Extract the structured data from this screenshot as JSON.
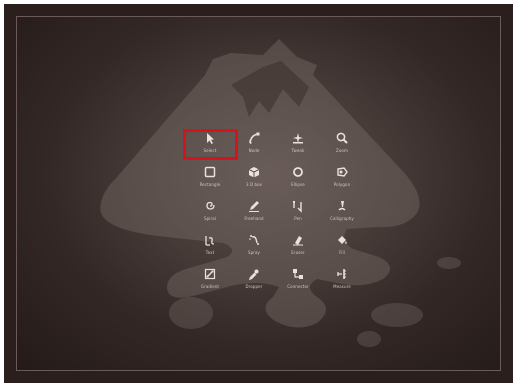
{
  "tools": [
    {
      "label": "Select",
      "icon": "select-arrow-icon"
    },
    {
      "label": "Node",
      "icon": "node-tool-icon"
    },
    {
      "label": "Tweak",
      "icon": "tweak-tool-icon"
    },
    {
      "label": "Zoom",
      "icon": "zoom-icon"
    },
    {
      "label": "Rectangle",
      "icon": "rectangle-icon"
    },
    {
      "label": "3 D box",
      "icon": "3d-box-icon"
    },
    {
      "label": "Ellipse",
      "icon": "ellipse-icon"
    },
    {
      "label": "Polygon",
      "icon": "polygon-star-icon"
    },
    {
      "label": "Spiral",
      "icon": "spiral-icon"
    },
    {
      "label": "Freehand",
      "icon": "pencil-icon"
    },
    {
      "label": "Pen",
      "icon": "pen-icon"
    },
    {
      "label": "Calligraphy",
      "icon": "calligraphy-icon"
    },
    {
      "label": "Text",
      "icon": "text-icon"
    },
    {
      "label": "Spray",
      "icon": "spray-icon"
    },
    {
      "label": "Eraser",
      "icon": "eraser-icon"
    },
    {
      "label": "Fill",
      "icon": "paint-bucket-icon"
    },
    {
      "label": "Gradient",
      "icon": "gradient-icon"
    },
    {
      "label": "Dropper",
      "icon": "dropper-icon"
    },
    {
      "label": "Connector",
      "icon": "connector-icon"
    },
    {
      "label": "Measure",
      "icon": "measure-icon"
    }
  ],
  "highlight_color": "#d4141c",
  "selected_tool": "Select"
}
